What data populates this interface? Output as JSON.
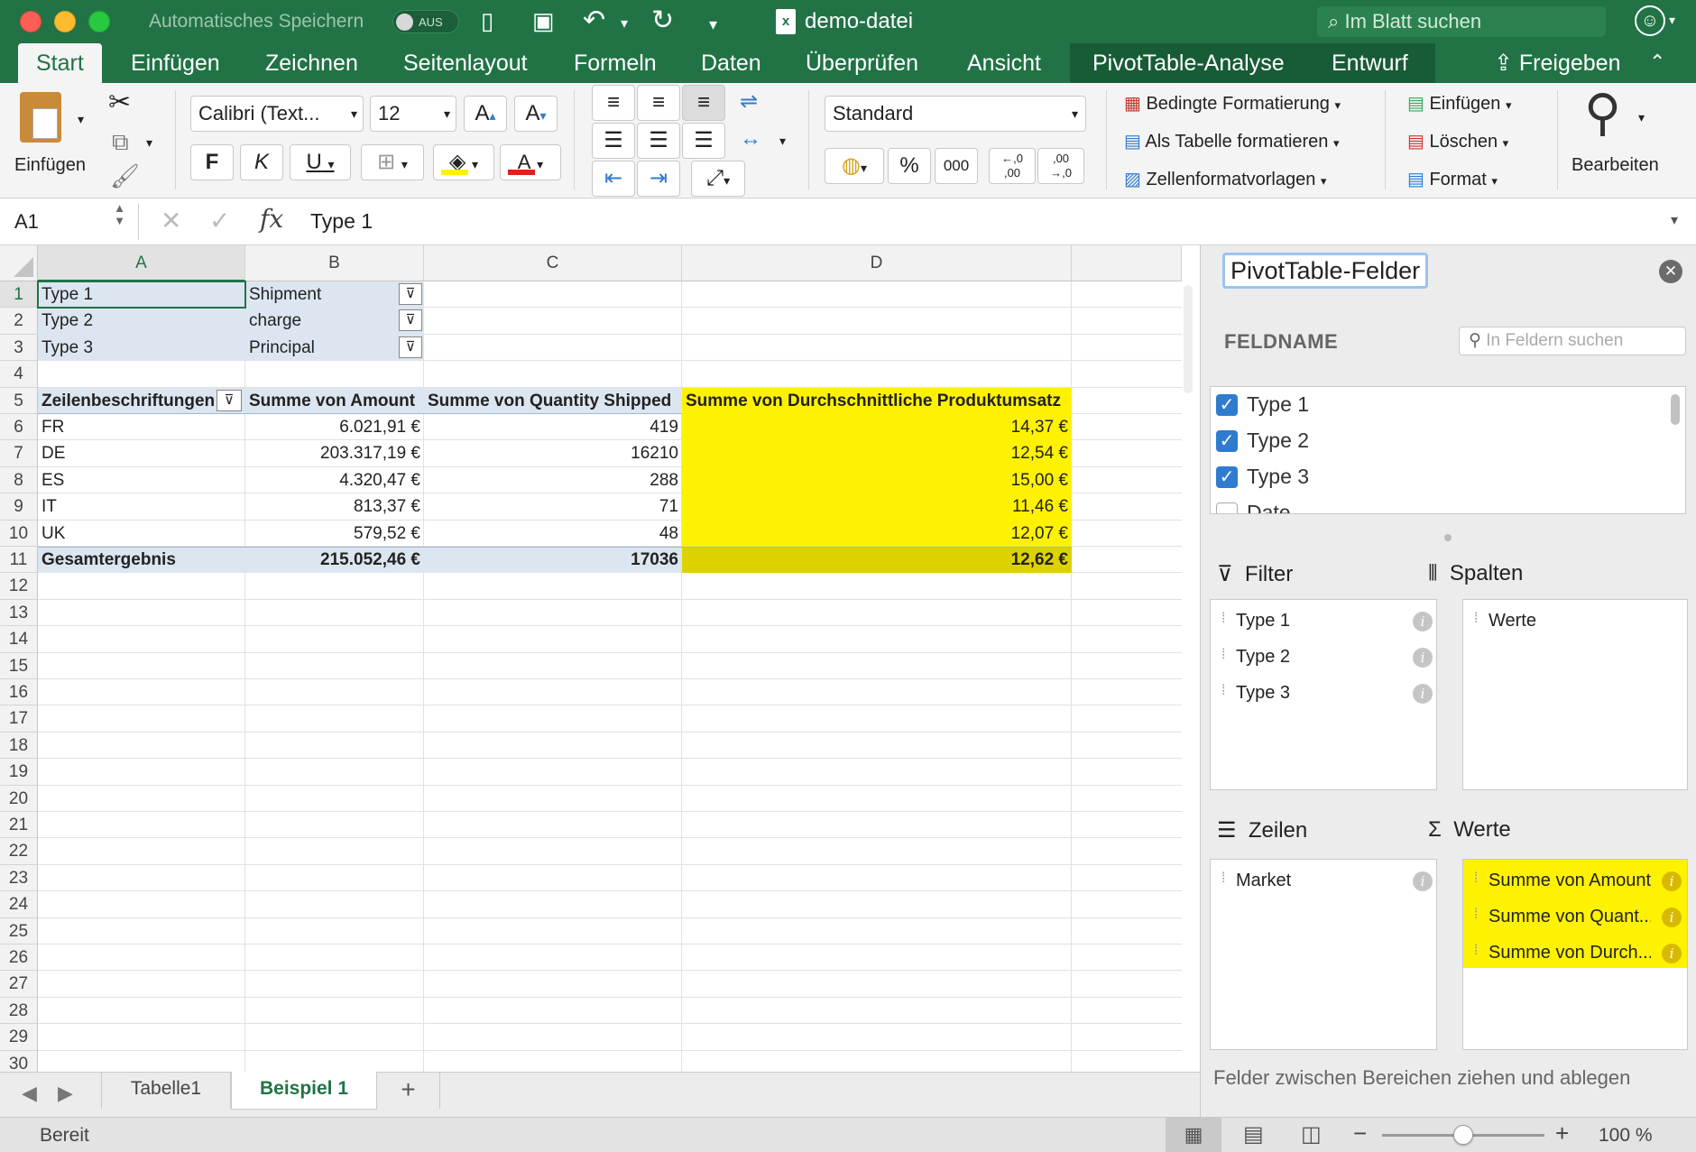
{
  "window": {
    "autosave_label": "Automatisches Speichern",
    "autosave_state": "AUS",
    "title": "demo-datei",
    "search_placeholder": "Im Blatt suchen"
  },
  "tabs": [
    "Start",
    "Einfügen",
    "Zeichnen",
    "Seitenlayout",
    "Formeln",
    "Daten",
    "Überprüfen",
    "Ansicht",
    "PivotTable-Analyse",
    "Entwurf"
  ],
  "share_label": "Freigeben",
  "ribbon": {
    "paste_label": "Einfügen",
    "font_name": "Calibri (Text...",
    "font_size": "12",
    "bold": "F",
    "italic": "K",
    "underline": "U",
    "number_format": "Standard",
    "percent": "%",
    "thousands": "000",
    "dec_inc_top": "←,0",
    "dec_inc_bottom": ",00",
    "dec_dec_top": ",00",
    "dec_dec_bottom": "→,0",
    "cond_format": "Bedingte Formatierung",
    "format_table": "Als Tabelle formatieren",
    "cell_styles": "Zellenformatvorlagen",
    "insert": "Einfügen",
    "delete": "Löschen",
    "format": "Format",
    "edit": "Bearbeiten"
  },
  "formula_bar": {
    "name_box": "A1",
    "fx": "fx",
    "content": "Type 1"
  },
  "columns": [
    "A",
    "B",
    "C",
    "D"
  ],
  "rows": [
    "1",
    "2",
    "3",
    "4",
    "5",
    "6",
    "7",
    "8",
    "9",
    "10",
    "11",
    "12",
    "13",
    "14",
    "15",
    "16",
    "17",
    "18",
    "19",
    "20",
    "21",
    "22",
    "23",
    "24",
    "25",
    "26",
    "27",
    "28",
    "29",
    "30"
  ],
  "sheet": {
    "filters": [
      {
        "label": "Type 1",
        "value": "Shipment"
      },
      {
        "label": "Type 2",
        "value": "charge"
      },
      {
        "label": "Type 3",
        "value": "Principal"
      }
    ],
    "headers": [
      "Zeilenbeschriftungen",
      "Summe von Amount",
      "Summe von Quantity Shipped",
      "Summe von Durchschnittliche Produktumsatz"
    ],
    "data": [
      [
        "FR",
        "6.021,91 €",
        "419",
        "14,37 €"
      ],
      [
        "DE",
        "203.317,19 €",
        "16210",
        "12,54 €"
      ],
      [
        "ES",
        "4.320,47 €",
        "288",
        "15,00 €"
      ],
      [
        "IT",
        "813,37 €",
        "71",
        "11,46 €"
      ],
      [
        "UK",
        "579,52 €",
        "48",
        "12,07 €"
      ]
    ],
    "total": [
      "Gesamtergebnis",
      "215.052,46 €",
      "17036",
      "12,62 €"
    ]
  },
  "pivot": {
    "title": "PivotTable-Felder",
    "fieldname_label": "FELDNAME",
    "search_placeholder": "In Feldern suchen",
    "fields": [
      "Type 1",
      "Type 2",
      "Type 3",
      "Date"
    ],
    "filter_label": "Filter",
    "columns_label": "Spalten",
    "rows_label": "Zeilen",
    "values_label": "Werte",
    "filter_items": [
      "Type 1",
      "Type 2",
      "Type 3"
    ],
    "column_items": [
      "Werte"
    ],
    "row_items": [
      "Market"
    ],
    "value_items": [
      "Summe von Amount",
      "Summe von Quant...",
      "Summe von Durch..."
    ],
    "footer": "Felder zwischen Bereichen ziehen und ablegen"
  },
  "sheet_tabs": [
    "Tabelle1",
    "Beispiel 1"
  ],
  "status": {
    "ready": "Bereit",
    "zoom": "100 %",
    "zoom_level": 0.5
  },
  "colors": {
    "excel_green": "#217346",
    "highlight_yellow": "#fff200",
    "total_yellow": "#ddd200",
    "pivot_blue": "#dce6f1"
  }
}
